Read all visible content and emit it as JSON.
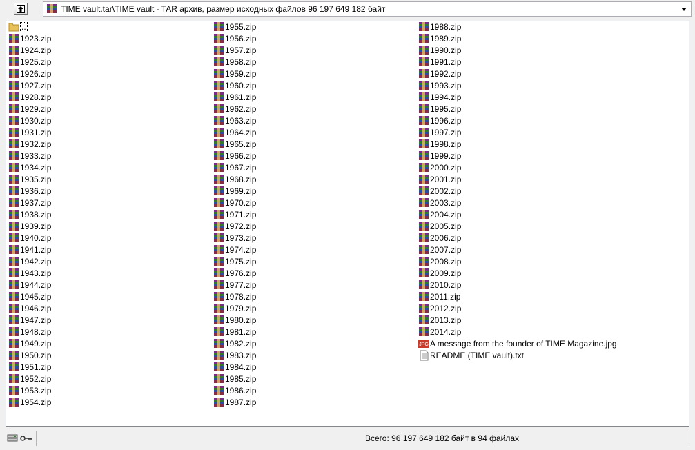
{
  "path_bar": {
    "path_text": "TIME vault.tar\\TIME vault - TAR архив, размер исходных файлов 96 197 649 182 байт"
  },
  "files": {
    "parent": "..",
    "column1": [
      "1923.zip",
      "1924.zip",
      "1925.zip",
      "1926.zip",
      "1927.zip",
      "1928.zip",
      "1929.zip",
      "1930.zip",
      "1931.zip",
      "1932.zip",
      "1933.zip",
      "1934.zip",
      "1935.zip",
      "1936.zip",
      "1937.zip",
      "1938.zip",
      "1939.zip",
      "1940.zip",
      "1941.zip",
      "1942.zip",
      "1943.zip",
      "1944.zip",
      "1945.zip",
      "1946.zip",
      "1947.zip",
      "1948.zip",
      "1949.zip",
      "1950.zip",
      "1951.zip",
      "1952.zip",
      "1953.zip",
      "1954.zip"
    ],
    "column2": [
      "1955.zip",
      "1956.zip",
      "1957.zip",
      "1958.zip",
      "1959.zip",
      "1960.zip",
      "1961.zip",
      "1962.zip",
      "1963.zip",
      "1964.zip",
      "1965.zip",
      "1966.zip",
      "1967.zip",
      "1968.zip",
      "1969.zip",
      "1970.zip",
      "1971.zip",
      "1972.zip",
      "1973.zip",
      "1974.zip",
      "1975.zip",
      "1976.zip",
      "1977.zip",
      "1978.zip",
      "1979.zip",
      "1980.zip",
      "1981.zip",
      "1982.zip",
      "1983.zip",
      "1984.zip",
      "1985.zip",
      "1986.zip",
      "1987.zip"
    ],
    "column3": [
      "1988.zip",
      "1989.zip",
      "1990.zip",
      "1991.zip",
      "1992.zip",
      "1993.zip",
      "1994.zip",
      "1995.zip",
      "1996.zip",
      "1997.zip",
      "1998.zip",
      "1999.zip",
      "2000.zip",
      "2001.zip",
      "2002.zip",
      "2003.zip",
      "2004.zip",
      "2005.zip",
      "2006.zip",
      "2007.zip",
      "2008.zip",
      "2009.zip",
      "2010.zip",
      "2011.zip",
      "2012.zip",
      "2013.zip",
      "2014.zip"
    ],
    "jpg_file": "A message from the founder of TIME Magazine.jpg",
    "jpg_badge": "JPG",
    "txt_file": "README (TIME vault).txt"
  },
  "icons": {
    "up_button": "up-folder-icon",
    "archive": "rar-archive-icon",
    "folder": "folder-icon",
    "jpg": "jpg-file-icon",
    "txt": "text-file-icon",
    "status_drive": "drive-icon",
    "status_key": "key-icon"
  },
  "status": {
    "summary": "Всего: 96 197 649 182 байт в 94 файлах"
  }
}
